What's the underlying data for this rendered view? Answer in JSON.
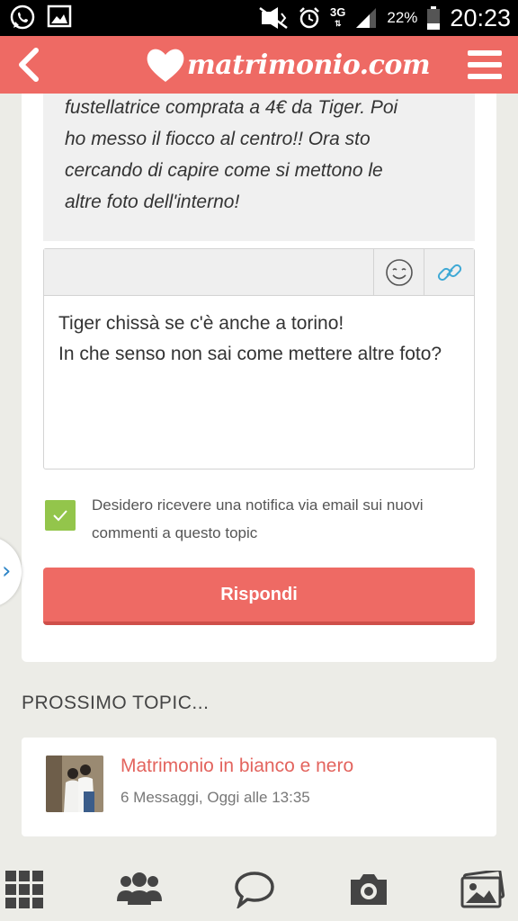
{
  "status_bar": {
    "battery": "22%",
    "network": "3G",
    "time": "20:23"
  },
  "header": {
    "logo_text": "matrimonio.com",
    "brand_color": "#ee6a64"
  },
  "quote": {
    "lines": [
      "fustellatrice comprata a 4€ da Tiger. Poi",
      "ho messo il fiocco al centro!! Ora sto",
      "cercando di capire come si mettono le",
      "altre foto dell'interno!"
    ]
  },
  "editor": {
    "lines": [
      "Tiger chissà se c'è anche a torino!",
      "In che senso non sai come mettere altre foto?"
    ],
    "toolbar_icons": [
      "smiley-icon",
      "link-icon"
    ]
  },
  "notify": {
    "checked": true,
    "label": "Desidero ricevere una notifica via email sui nuovi commenti a questo topic"
  },
  "reply_button": "Rispondi",
  "next_topic": {
    "section_title": "PROSSIMO TOPIC...",
    "title": "Matrimonio in bianco e nero",
    "meta": "6 Messaggi, Oggi alle 13:35"
  },
  "bottom_nav": [
    "grid-icon",
    "community-icon",
    "chat-icon",
    "camera-icon",
    "photos-icon"
  ]
}
